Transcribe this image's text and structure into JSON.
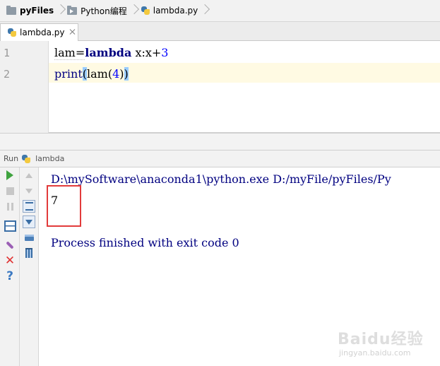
{
  "breadcrumb": {
    "items": [
      {
        "label": "pyFiles",
        "icon": "folder-icon"
      },
      {
        "label": "Python编程",
        "icon": "package-folder-icon"
      },
      {
        "label": "lambda.py",
        "icon": "python-file-icon"
      }
    ]
  },
  "tabs": [
    {
      "label": "lambda.py",
      "icon": "python-file-icon",
      "active": true
    }
  ],
  "editor": {
    "lines": [
      {
        "number": "1",
        "text": "lam=lambda x:x+3"
      },
      {
        "number": "2",
        "text": "print(lam(4))"
      }
    ],
    "tokens": {
      "line1_var": "lam=",
      "line1_kw": "lambda",
      "line1_rest": " x:x+",
      "line1_num": "3",
      "line2_fn": "print",
      "line2_open": "(",
      "line2_mid": "lam(",
      "line2_num": "4",
      "line2_close_inner": ")",
      "line2_close": ")"
    }
  },
  "run_panel": {
    "title": "Run",
    "config_name": "lambda"
  },
  "console": {
    "command": "D:\\mySoftware\\anaconda1\\python.exe D:/myFile/pyFiles/Py",
    "output": "7",
    "exit_message": "Process finished with exit code 0"
  },
  "watermark": {
    "logo": "Baidu经验",
    "url": "jingyan.baidu.com"
  },
  "colors": {
    "keyword": "#000080",
    "number": "#0000ff",
    "highlight_box": "#e23b3b",
    "caret_line": "#fffae3",
    "brace_match": "#99ccff"
  }
}
